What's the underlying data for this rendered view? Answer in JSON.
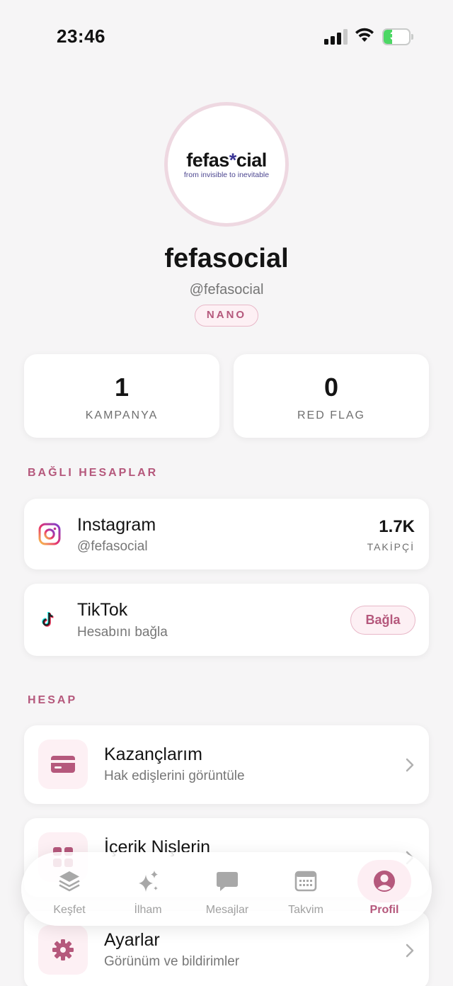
{
  "status_bar": {
    "time": "23:46",
    "battery": "33",
    "battery_level": 0.33
  },
  "profile": {
    "logo_word_a": "fefas",
    "logo_star": "*",
    "logo_word_b": "cial",
    "logo_tagline": "from invisible to inevitable",
    "name": "fefasocial",
    "handle": "@fefasocial",
    "tier": "NANO"
  },
  "stats": [
    {
      "value": "1",
      "label": "KAMPANYA"
    },
    {
      "value": "0",
      "label": "RED FLAG"
    }
  ],
  "linked_section_title": "BAĞLI HESAPLAR",
  "accounts": {
    "instagram": {
      "name": "Instagram",
      "handle": "@fefasocial",
      "followers": "1.7K",
      "followers_label": "TAKİPÇİ",
      "icon": "instagram-icon"
    },
    "tiktok": {
      "name": "TikTok",
      "sub": "Hesabını bağla",
      "connect_label": "Bağla",
      "icon": "tiktok-icon"
    }
  },
  "account_section_title": "HESAP",
  "menu": [
    {
      "title": "Kazançlarım",
      "sub": "Hak edişlerini görüntüle",
      "icon": "credit-card-icon"
    },
    {
      "title": "İçerik Nişlerin",
      "sub": "",
      "icon": "grid-icon"
    },
    {
      "title": "Ayarlar",
      "sub": "Görünüm ve bildirimler",
      "icon": "gear-icon"
    }
  ],
  "tabs": [
    {
      "label": "Keşfet",
      "icon": "layers-icon"
    },
    {
      "label": "İlham",
      "icon": "sparkles-icon"
    },
    {
      "label": "Mesajlar",
      "icon": "chat-bubble-icon"
    },
    {
      "label": "Takvim",
      "icon": "calendar-icon"
    },
    {
      "label": "Profil",
      "icon": "user-circle-icon",
      "active": true
    }
  ],
  "colors": {
    "accent": "#b5587c",
    "accent_bg": "#fdf0f4",
    "background": "#f6f5f6"
  }
}
